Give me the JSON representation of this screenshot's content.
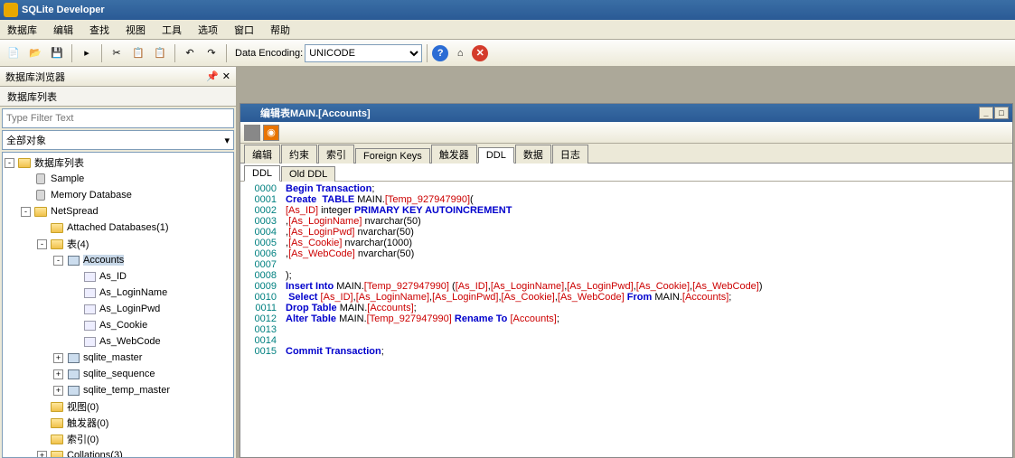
{
  "title": "SQLite Developer",
  "menu": [
    "数据库",
    "编辑",
    "查找",
    "视图",
    "工具",
    "选项",
    "窗口",
    "帮助"
  ],
  "toolbar": {
    "encoding_label": "Data Encoding:",
    "encoding_value": "UNICODE"
  },
  "sidebar": {
    "title": "数据库浏览器",
    "tab": "数据库列表",
    "filter_placeholder": "Type Filter Text",
    "scope": "全部对象",
    "root": "数据库列表",
    "items": {
      "sample": "Sample",
      "memdb": "Memory Database",
      "netspread": "NetSpread",
      "attached": "Attached Databases(1)",
      "tables": "表(4)",
      "accounts": "Accounts",
      "cols": [
        "As_ID",
        "As_LoginName",
        "As_LoginPwd",
        "As_Cookie",
        "As_WebCode"
      ],
      "sqlite_master": "sqlite_master",
      "sqlite_sequence": "sqlite_sequence",
      "sqlite_temp_master": "sqlite_temp_master",
      "views": "视图(0)",
      "triggers": "触发器(0)",
      "indexes": "索引(0)",
      "collations": "Collations(3)"
    }
  },
  "doc": {
    "title": "编辑表MAIN.[Accounts]",
    "tabs": [
      "编辑",
      "约束",
      "索引",
      "Foreign Keys",
      "触发器",
      "DDL",
      "数据",
      "日志"
    ],
    "active_tab": "DDL",
    "subtabs": [
      "DDL",
      "Old DDL"
    ],
    "active_subtab": "DDL",
    "code": [
      {
        "n": "0000",
        "h": "<span class='kw'>Begin Transaction</span>;"
      },
      {
        "n": "0001",
        "h": "<span class='kw'>Create  TABLE</span> MAIN.<span class='id'>[Temp_927947990]</span>("
      },
      {
        "n": "0002",
        "h": "<span class='id'>[As_ID]</span> integer <span class='kw'>PRIMARY KEY AUTOINCREMENT</span>"
      },
      {
        "n": "0003",
        "h": ",<span class='id'>[As_LoginName]</span> nvarchar(50)"
      },
      {
        "n": "0004",
        "h": ",<span class='id'>[As_LoginPwd]</span> nvarchar(50)"
      },
      {
        "n": "0005",
        "h": ",<span class='id'>[As_Cookie]</span> nvarchar(1000)"
      },
      {
        "n": "0006",
        "h": ",<span class='id'>[As_WebCode]</span> nvarchar(50)"
      },
      {
        "n": "0007",
        "h": ""
      },
      {
        "n": "0008",
        "h": ");"
      },
      {
        "n": "0009",
        "h": "<span class='kw'>Insert Into</span> MAIN.<span class='id'>[Temp_927947990]</span> (<span class='id'>[As_ID]</span>,<span class='id'>[As_LoginName]</span>,<span class='id'>[As_LoginPwd]</span>,<span class='id'>[As_Cookie]</span>,<span class='id'>[As_WebCode]</span>)"
      },
      {
        "n": "0010",
        "h": " <span class='kw'>Select</span> <span class='id'>[As_ID]</span>,<span class='id'>[As_LoginName]</span>,<span class='id'>[As_LoginPwd]</span>,<span class='id'>[As_Cookie]</span>,<span class='id'>[As_WebCode]</span> <span class='kw'>From</span> MAIN.<span class='id'>[Accounts]</span>;"
      },
      {
        "n": "0011",
        "h": "<span class='kw'>Drop Table</span> MAIN.<span class='id'>[Accounts]</span>;"
      },
      {
        "n": "0012",
        "h": "<span class='kw'>Alter Table</span> MAIN.<span class='id'>[Temp_927947990]</span> <span class='kw'>Rename To</span> <span class='id'>[Accounts]</span>;"
      },
      {
        "n": "0013",
        "h": ""
      },
      {
        "n": "0014",
        "h": ""
      },
      {
        "n": "0015",
        "h": "<span class='kw'>Commit Transaction</span>;"
      }
    ]
  }
}
